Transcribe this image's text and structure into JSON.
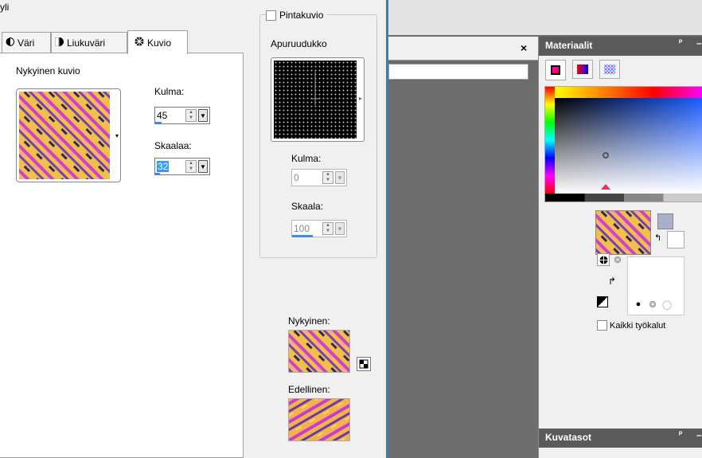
{
  "left_dialog": {
    "title_fragment": "yli",
    "tabs": [
      {
        "label": "Väri",
        "icon": "circle-half-icon"
      },
      {
        "label": "Liukuväri",
        "icon": "gradient-icon"
      },
      {
        "label": "Kuvio",
        "icon": "pattern-icon"
      }
    ],
    "current_pattern_label": "Nykyinen kuvio",
    "angle_label": "Kulma:",
    "angle_value": "45",
    "scale_label": "Skaalaa:",
    "scale_value": "32"
  },
  "middle_panel": {
    "texture_checkbox_label": "Pintakuvio",
    "grid_label": "Apuruudukko",
    "angle_label": "Kulma:",
    "angle_value": "0",
    "scale_label": "Skaala:",
    "scale_value": "100",
    "current_label": "Nykyinen:",
    "previous_label": "Edellinen:"
  },
  "workspace": {
    "close_glyph": "×"
  },
  "materials_panel": {
    "title": "Materiaalit",
    "pin_glyph": "ᴾ",
    "minimize_glyph": "–",
    "all_tools_label": "Kaikki työkalut"
  },
  "layers_panel": {
    "title": "Kuvatasot",
    "pin_glyph": "ᴾ",
    "minimize_glyph": "–"
  },
  "colors": {
    "selection": "#3399ff",
    "title_bar": "#5a5a5a",
    "divider": "#3e7fb0"
  }
}
